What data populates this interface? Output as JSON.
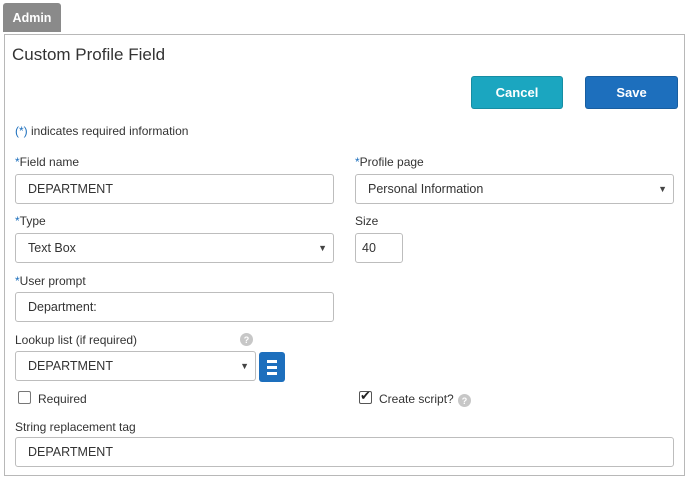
{
  "tab": {
    "label": "Admin"
  },
  "panel": {
    "title": "Custom Profile Field"
  },
  "buttons": {
    "cancel": "Cancel",
    "save": "Save"
  },
  "required_note": {
    "asterisk": "(*)",
    "text": " indicates required information"
  },
  "form": {
    "field_name": {
      "asterisk": "*",
      "label": "Field name",
      "value": "DEPARTMENT"
    },
    "profile_page": {
      "asterisk": "*",
      "label": "Profile page",
      "value": "Personal Information"
    },
    "type": {
      "asterisk": "*",
      "label": "Type",
      "value": "Text Box"
    },
    "size": {
      "label": "Size",
      "value": "40"
    },
    "user_prompt": {
      "asterisk": "*",
      "label": "User prompt",
      "value": "Department:"
    },
    "lookup_list": {
      "label": "Lookup list (if required)",
      "value": "DEPARTMENT"
    },
    "required": {
      "label": "Required",
      "checked": false
    },
    "create_script": {
      "label": "Create script?",
      "checked": true
    },
    "string_tag": {
      "label": "String replacement tag",
      "value": "DEPARTMENT"
    }
  },
  "icons": {
    "help": "?",
    "caret": "▼",
    "check": "✔"
  },
  "colors": {
    "tab_bg": "#8a8a8a",
    "cancel_bg": "#1ba6c0",
    "save_bg": "#1d6fbd",
    "asterisk": "#1d6fbd"
  }
}
